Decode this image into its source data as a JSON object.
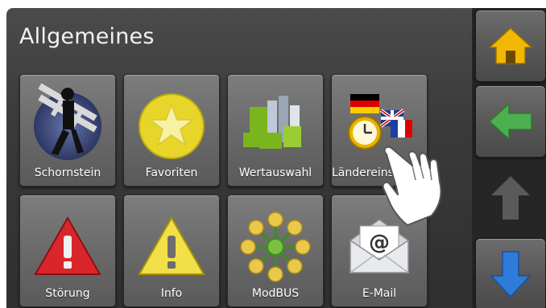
{
  "page": {
    "title": "Allgemeines"
  },
  "tiles": [
    {
      "label": "Schornstein",
      "icon": "chimney-sweep-icon"
    },
    {
      "label": "Favoriten",
      "icon": "star-icon"
    },
    {
      "label": "Wertauswahl",
      "icon": "value-selection-icon"
    },
    {
      "label": "Ländereinstellungen",
      "icon": "country-settings-icon"
    },
    {
      "label": "Störung",
      "icon": "error-warning-icon"
    },
    {
      "label": "Info",
      "icon": "info-warning-icon"
    },
    {
      "label": "ModBUS",
      "icon": "modbus-network-icon"
    },
    {
      "label": "E-Mail",
      "icon": "email-icon"
    }
  ],
  "sidebar": {
    "buttons": [
      {
        "icon": "home-icon",
        "color": "#f2b705"
      },
      {
        "icon": "arrow-left-icon",
        "color": "#4caf50"
      },
      {
        "icon": "arrow-up-icon",
        "color": "#5a5a5a"
      },
      {
        "icon": "arrow-down-icon",
        "color": "#2f7bd9"
      }
    ]
  },
  "pointer": {
    "icon": "hand-pointer-icon"
  }
}
